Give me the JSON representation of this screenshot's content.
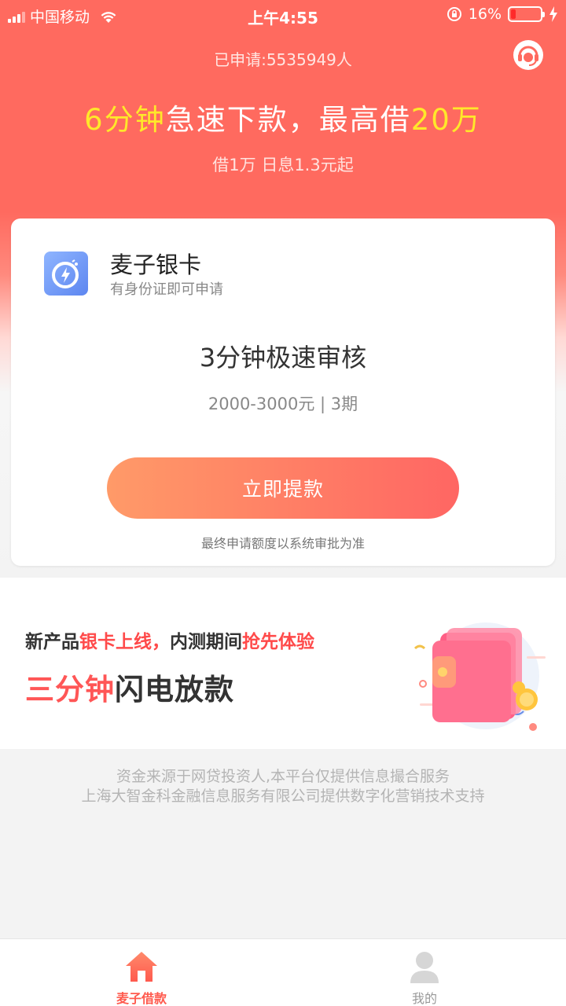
{
  "status_bar": {
    "carrier": "中国移动",
    "time": "上午4:55",
    "battery_percent": "16%",
    "battery_level": 0.16
  },
  "header": {
    "applied_count": "已申请:5535949人",
    "headline_part1": "6分钟",
    "headline_part2": "急速下款，最高借",
    "headline_part3": "20万",
    "subline": "借1万 日息1.3元起"
  },
  "card": {
    "app_name": "麦子银卡",
    "app_subtitle": "有身份证即可申请",
    "title": "3分钟极速审核",
    "range": "2000-3000元 | 3期",
    "button_label": "立即提款",
    "note": "最终申请额度以系统审批为准"
  },
  "promo": {
    "line1_a": "新产品",
    "line1_b": "银卡上线，",
    "line1_c": "内测期间",
    "line1_d": "抢先体验",
    "line2_a": "三分钟",
    "line2_b": "闪电放款"
  },
  "disclaimer": {
    "line1": "资金来源于网贷投资人,本平台仅提供信息撮合服务",
    "line2": "上海大智金科金融信息服务有限公司提供数字化营销技术支持"
  },
  "tabs": [
    {
      "label": "麦子借款",
      "icon": "home-icon",
      "active": true
    },
    {
      "label": "我的",
      "icon": "user-icon",
      "active": false
    }
  ],
  "colors": {
    "brand_red": "#ff6a5f",
    "highlight_yellow": "#ffe82a",
    "accent_red": "#ff4a4a"
  }
}
